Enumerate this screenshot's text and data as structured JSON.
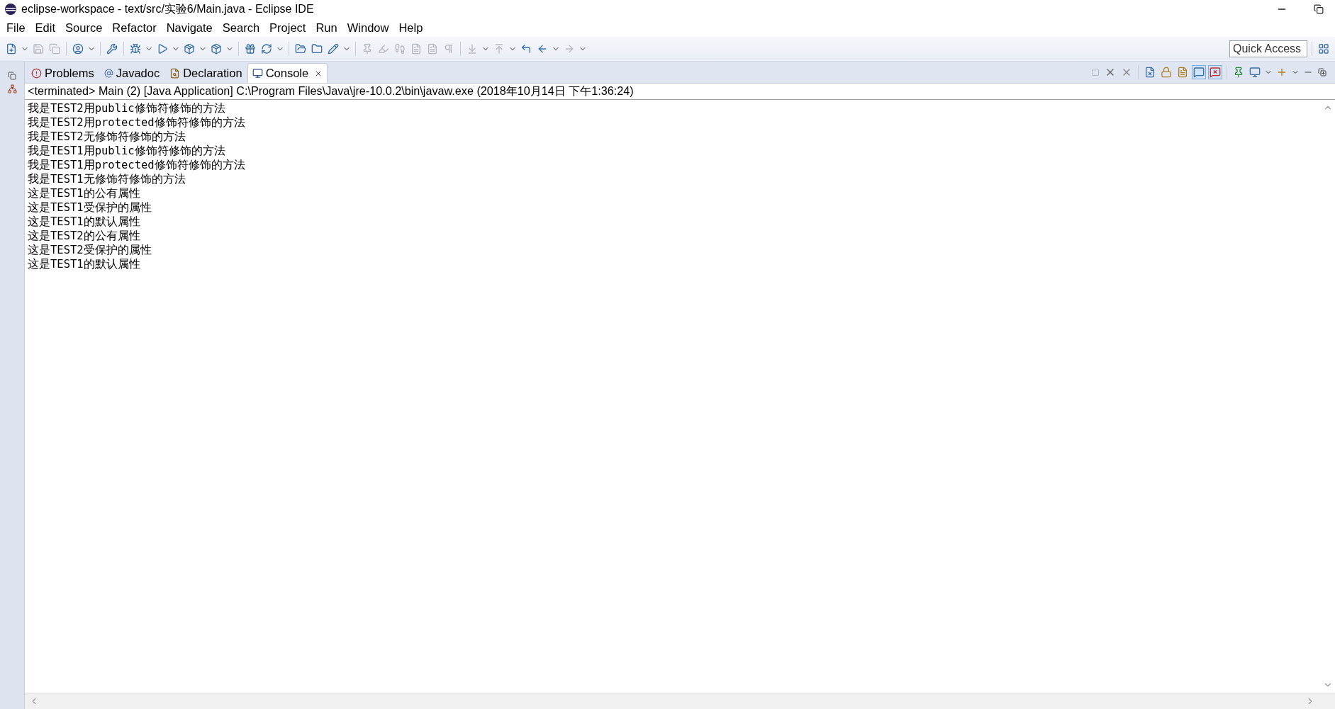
{
  "window": {
    "title": "eclipse-workspace - text/src/实验6/Main.java - Eclipse IDE"
  },
  "menu": [
    "File",
    "Edit",
    "Source",
    "Refactor",
    "Navigate",
    "Search",
    "Project",
    "Run",
    "Window",
    "Help"
  ],
  "quick_access": {
    "placeholder": "Quick Access"
  },
  "tabs": [
    {
      "label": "Problems",
      "kind": "problems",
      "selected": false,
      "closable": false
    },
    {
      "label": "Javadoc",
      "kind": "javadoc",
      "selected": false,
      "closable": false
    },
    {
      "label": "Declaration",
      "kind": "declaration",
      "selected": false,
      "closable": false
    },
    {
      "label": "Console",
      "kind": "console",
      "selected": true,
      "closable": true
    }
  ],
  "console_toggles": [
    {
      "selected": true
    },
    {
      "selected": true
    }
  ],
  "console": {
    "header": "<terminated> Main (2) [Java Application] C:\\Program Files\\Java\\jre-10.0.2\\bin\\javaw.exe (2018年10月14日 下午1:36:24)",
    "lines": [
      "我是TEST2用public修饰符修饰的方法",
      "我是TEST2用protected修饰符修饰的方法",
      "我是TEST2无修饰符修饰的方法",
      "我是TEST1用public修饰符修饰的方法",
      "我是TEST1用protected修饰符修饰的方法",
      "我是TEST1无修饰符修饰的方法",
      "这是TEST1的公有属性",
      "这是TEST1受保护的属性",
      "这是TEST1的默认属性",
      "这是TEST2的公有属性",
      "这是TEST2受保护的属性",
      "这是TEST1的默认属性"
    ]
  }
}
